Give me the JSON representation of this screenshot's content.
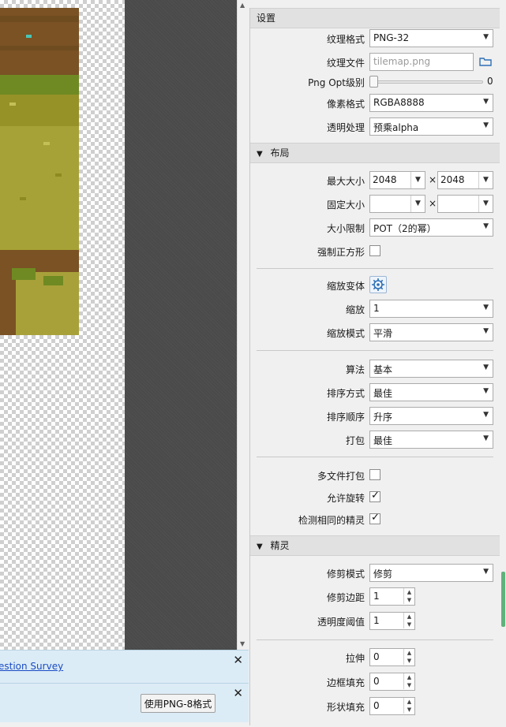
{
  "canvas": {
    "notice_survey": {
      "link": "estion Survey"
    },
    "notice_png8": {
      "button": "使用PNG-8格式"
    }
  },
  "panel": {
    "settings": {
      "header": "设置",
      "texture_format": {
        "label": "纹理格式",
        "value": "PNG-32"
      },
      "texture_file": {
        "label": "纹理文件",
        "placeholder": "tilemap.png"
      },
      "png_opt": {
        "label": "Png Opt级别",
        "value": "0",
        "level": 0
      },
      "pixel_format": {
        "label": "像素格式",
        "value": "RGBA8888"
      },
      "alpha": {
        "label": "透明处理",
        "value": "预乘alpha"
      }
    },
    "layout": {
      "header": "布局",
      "max_size": {
        "label": "最大大小",
        "w": "2048",
        "h": "2048",
        "times": "×"
      },
      "fixed_size": {
        "label": "固定大小",
        "w": "",
        "h": "",
        "times": "×"
      },
      "size_limit": {
        "label": "大小限制",
        "value": "POT（2的幂）"
      },
      "force_square": {
        "label": "强制正方形",
        "checked": false
      },
      "scale_variants": {
        "label": "缩放变体"
      },
      "scale": {
        "label": "缩放",
        "value": "1"
      },
      "scale_mode": {
        "label": "缩放模式",
        "value": "平滑"
      },
      "algorithm": {
        "label": "算法",
        "value": "基本"
      },
      "sort_by": {
        "label": "排序方式",
        "value": "最佳"
      },
      "sort_order": {
        "label": "排序顺序",
        "value": "升序"
      },
      "pack": {
        "label": "打包",
        "value": "最佳"
      },
      "multipack": {
        "label": "多文件打包",
        "checked": false
      },
      "allow_rotation": {
        "label": "允许旋转",
        "checked": true
      },
      "detect_identical": {
        "label": "检测相同的精灵",
        "checked": true
      }
    },
    "sprites": {
      "header": "精灵",
      "trim_mode": {
        "label": "修剪模式",
        "value": "修剪"
      },
      "trim_margin": {
        "label": "修剪边距",
        "value": "1"
      },
      "alpha_threshold": {
        "label": "透明度阈值",
        "value": "1"
      },
      "extrude": {
        "label": "拉伸",
        "value": "0"
      },
      "border_padding": {
        "label": "边框填充",
        "value": "0"
      },
      "shape_padding": {
        "label": "形状填充",
        "value": "0"
      }
    }
  },
  "colors": {
    "accent": "#5fb27a",
    "link": "#1a4bc4",
    "notice_bg": "#dcecf6"
  }
}
